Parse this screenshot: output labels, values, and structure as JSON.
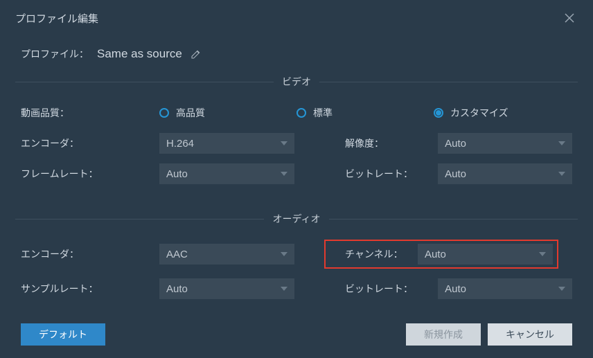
{
  "header": {
    "title": "プロファイル編集"
  },
  "profile": {
    "label": "プロファイル：",
    "name": "Same as source"
  },
  "sections": {
    "video": "ビデオ",
    "audio": "オーディオ"
  },
  "video": {
    "quality_label": "動画品質：",
    "radios": {
      "high": "高品質",
      "standard": "標準",
      "custom": "カスタマイズ"
    },
    "encoder_label": "エンコーダ：",
    "encoder_value": "H.264",
    "resolution_label": "解像度：",
    "resolution_value": "Auto",
    "framerate_label": "フレームレート：",
    "framerate_value": "Auto",
    "bitrate_label": "ビットレート：",
    "bitrate_value": "Auto"
  },
  "audio": {
    "encoder_label": "エンコーダ：",
    "encoder_value": "AAC",
    "channel_label": "チャンネル：",
    "channel_value": "Auto",
    "samplerate_label": "サンプルレート：",
    "samplerate_value": "Auto",
    "bitrate_label": "ビットレート：",
    "bitrate_value": "Auto"
  },
  "footer": {
    "default": "デフォルト",
    "create": "新規作成",
    "cancel": "キャンセル"
  }
}
